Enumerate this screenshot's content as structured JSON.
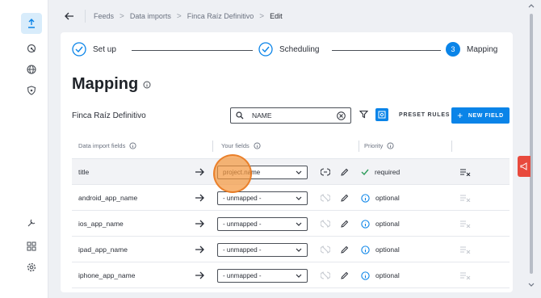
{
  "breadcrumb": {
    "items": [
      "Feeds",
      "Data imports",
      "Finca Raíz Definitivo"
    ],
    "current": "Edit",
    "separator": ">"
  },
  "steps": [
    {
      "label": "Set up",
      "state": "done"
    },
    {
      "label": "Scheduling",
      "state": "done"
    },
    {
      "label": "Mapping",
      "state": "active",
      "number": "3"
    }
  ],
  "page": {
    "title": "Mapping",
    "subtitle": "Finca Raíz Definitivo"
  },
  "search": {
    "value": "NAME"
  },
  "toolbar": {
    "preset_rules_label": "PRESET RULES",
    "new_field_label": "NEW FIELD"
  },
  "table": {
    "headers": {
      "import_field": "Data import fields",
      "your_fields": "Your fields",
      "priority": "Priority"
    },
    "rows": [
      {
        "field": "title",
        "mapped": "project.name",
        "priority": "required",
        "status": "check"
      },
      {
        "field": "android_app_name",
        "mapped": "- unmapped -",
        "priority": "optional",
        "status": "info"
      },
      {
        "field": "ios_app_name",
        "mapped": "- unmapped -",
        "priority": "optional",
        "status": "info"
      },
      {
        "field": "ipad_app_name",
        "mapped": "- unmapped -",
        "priority": "optional",
        "status": "info"
      },
      {
        "field": "iphone_app_name",
        "mapped": "- unmapped -",
        "priority": "optional",
        "status": "info"
      }
    ]
  },
  "colors": {
    "accent": "#0a84e8",
    "required_green": "#2e9d5b",
    "feedback_red": "#e84a3d"
  },
  "sidebar_icons": [
    "upload-icon",
    "radar-icon",
    "globe-icon",
    "shield-icon",
    "tools-icon",
    "grid-icon",
    "settings-icon"
  ]
}
